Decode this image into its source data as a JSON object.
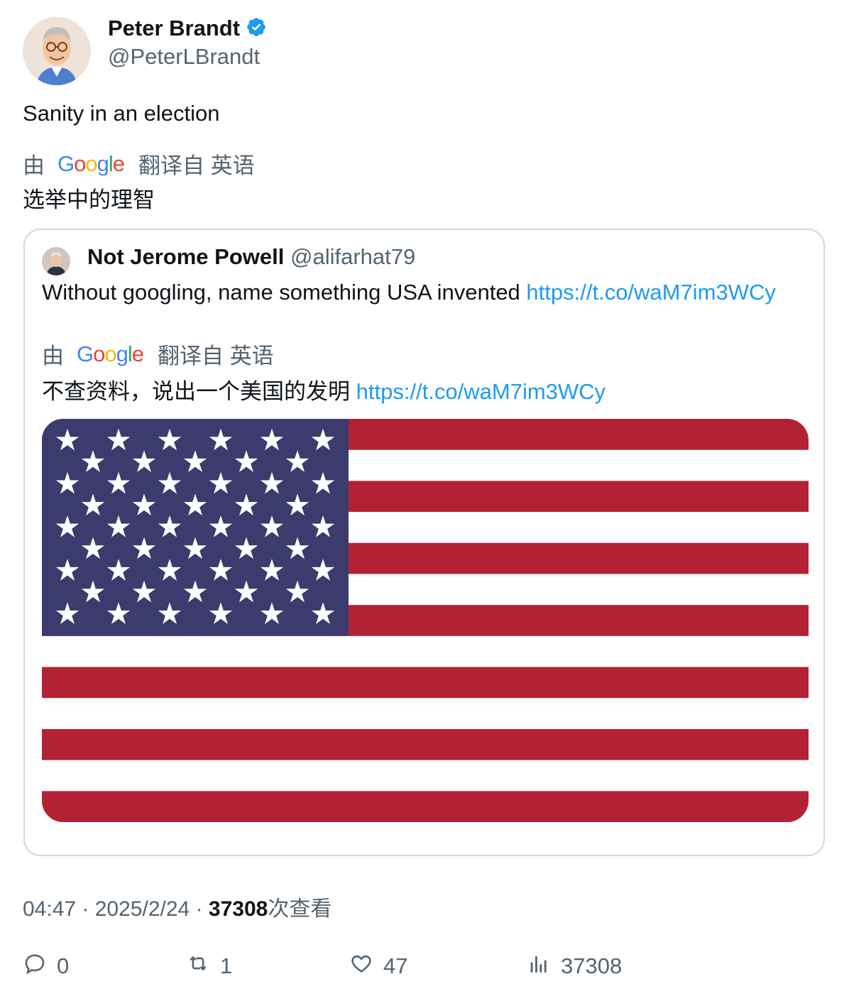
{
  "author": {
    "name": "Peter Brandt",
    "handle": "@PeterLBrandt",
    "verified": true,
    "verified_color": "#1d9bf0"
  },
  "tweet": {
    "text": "Sanity in an election",
    "translation": {
      "by": "由",
      "provider": "Google",
      "from": "翻译自 英语",
      "text": "选举中的理智"
    }
  },
  "quoted": {
    "name": "Not Jerome Powell",
    "handle": "@alifarhat79",
    "text": "Without googling, name something USA invented ",
    "link": "https://t.co/waM7im3WCy",
    "translation": {
      "by": "由",
      "provider": "Google",
      "from": "翻译自 英语",
      "text": "不查资料，说出一个美国的发明 ",
      "link": "https://t.co/waM7im3WCy"
    },
    "image": {
      "colors": {
        "red": "#b22234",
        "white": "#ffffff",
        "blue": "#3c3b6e"
      }
    }
  },
  "meta": {
    "time": "04:47",
    "sep1": " · ",
    "date": "2025/2/24",
    "sep2": " · ",
    "views": "37308",
    "views_label": "次查看"
  },
  "actions": {
    "replies": "0",
    "retweets": "1",
    "likes": "47",
    "views": "37308"
  },
  "colors": {
    "text": "#0f1419",
    "muted": "#536471",
    "link": "#1d9bf0",
    "border": "#cfd9de"
  },
  "icons": [
    "reply-icon",
    "retweet-icon",
    "like-icon",
    "views-icon",
    "verified-badge-icon",
    "google-logo"
  ]
}
